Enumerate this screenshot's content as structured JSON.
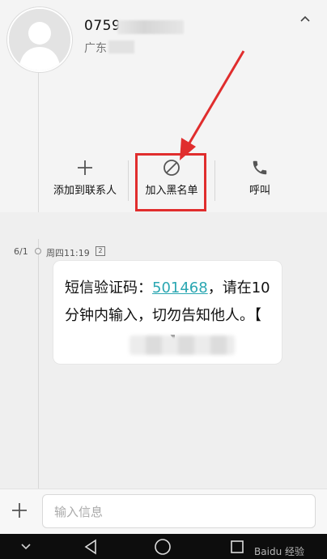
{
  "contact": {
    "number": "0759",
    "location": "广东"
  },
  "actions": [
    {
      "label": "添加到联系人",
      "icon": "plus-icon"
    },
    {
      "label": "加入黑名单",
      "icon": "block-icon"
    },
    {
      "label": "呼叫",
      "icon": "phone-icon"
    }
  ],
  "message": {
    "date": "6/1",
    "time": "周四11:19",
    "sim": "2",
    "text_before": "短信验证码：",
    "code": "501468",
    "text_after": "，请在10分钟内输入，切勿告知他人。【",
    "text_end": "】"
  },
  "input": {
    "placeholder": "输入信息"
  },
  "watermark": "Baidu 经验",
  "colors": {
    "accent": "#2ba7b2",
    "highlight": "#e02d2d"
  }
}
